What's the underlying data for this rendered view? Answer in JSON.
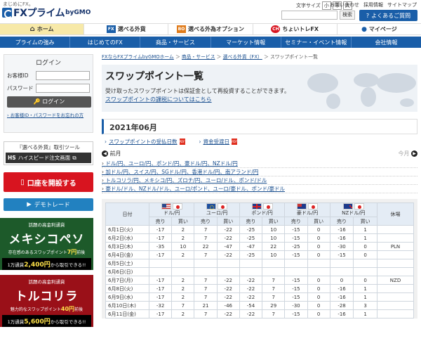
{
  "header": {
    "tagline": "まじめにFX。",
    "logo_text": "FXプライム",
    "logo_by": "byGMO",
    "font_size_label": "文字サイズ",
    "font_sizes": [
      "小",
      "中",
      "大"
    ],
    "top_links": [
      "お問い合わせ",
      "採用情報",
      "サイトマップ"
    ],
    "search_button": "検索",
    "faq_button": "よくあるご質問"
  },
  "global_nav": [
    {
      "label": "ホーム",
      "icon": "home-icon",
      "icon_text": "⌂"
    },
    {
      "label": "選べる外貨",
      "icon": "fx-icon",
      "icon_text": "FX"
    },
    {
      "label": "選べる外為オプション",
      "icon": "bo-icon",
      "icon_text": "BO"
    },
    {
      "label": "ちょいトレFX",
      "icon": "choitore-icon",
      "icon_text": "CH"
    },
    {
      "label": "マイページ",
      "icon": "user-icon",
      "icon_text": "●"
    }
  ],
  "sub_nav": [
    "プライムの強み",
    "はじめてのFX",
    "商品・サービス",
    "マーケット情報",
    "セミナー・イベント情報",
    "会社情報"
  ],
  "login": {
    "title": "ログイン",
    "id_label": "お客様ID",
    "password_label": "パスワード",
    "button": "ログイン",
    "forgot": "お客様ID・パスワードをお忘れの方"
  },
  "tool": {
    "title": "『選べる外貨』取引ツール",
    "button": "ハイスピード注文画面"
  },
  "open_account": "口座を開設する",
  "demo": "デモトレード",
  "banners": [
    {
      "small": "話題の高金利通貨",
      "big": "メキシコペソ",
      "swap_pre": "存在感のあるスワップポイント",
      "swap_val": "7円",
      "swap_post": "前後",
      "bottom_pre": "1万通貨",
      "bottom_val": "2,400円",
      "bottom_post": "から取引できる!!"
    },
    {
      "small": "話題の高金利通貨",
      "big": "トルコリラ",
      "swap_pre": "魅力的なスワップポイント",
      "swap_val": "40円",
      "swap_post": "前後",
      "bottom_pre": "1万通貨",
      "bottom_val": "5,600円",
      "bottom_post": "から取引できる!!"
    }
  ],
  "breadcrumb": {
    "items": [
      "FXならFXプライムbyGMOホーム",
      "商品・サービス",
      "選べる外貨（FX）"
    ],
    "current": "スワップポイント一覧",
    "separator": "＞"
  },
  "hero": {
    "title": "スワップポイント一覧",
    "desc": "受け取ったスワップポイントは保証金として再投資することができます。",
    "link": "スワップポイントの課税についてはこちら"
  },
  "month": "2021年06月",
  "files": [
    "スワップポイントの受払日数",
    "資金受渡日"
  ],
  "nav": {
    "prev": "前月",
    "next": "今月"
  },
  "pairs": [
    "ドル/円、ユーロ/円、ポンド/円、豪ドル/円、NZドル/円",
    "加ドル/円、スイス/円、SGドル/円、香港ドル/円、南アランド/円",
    "トルコリラ/円、メキシコ/円、ズロチ/円、ユーロ/ドル、ポンド/ドル",
    "豪ドル/ドル、NZドル/ドル、ユーロ/ポンド、ユーロ/豪ドル、ポンド/豪ドル"
  ],
  "table": {
    "date_header": "日付",
    "holiday_header": "休場",
    "sell": "売り",
    "buy": "買い",
    "currencies": [
      {
        "name": "ドル/円",
        "flag_a": "us-flag-icon",
        "flag_b": "jp-flag-icon"
      },
      {
        "name": "ユーロ/円",
        "flag_a": "eu-flag-icon",
        "flag_b": "jp-flag-icon"
      },
      {
        "name": "ポンド/円",
        "flag_a": "gb-flag-icon",
        "flag_b": "jp-flag-icon"
      },
      {
        "name": "豪ドル/円",
        "flag_a": "au-flag-icon",
        "flag_b": "jp-flag-icon"
      },
      {
        "name": "NZドル/円",
        "flag_a": "nz-flag-icon",
        "flag_b": "jp-flag-icon"
      }
    ],
    "rows": [
      {
        "date": "6月1日(火)",
        "values": [
          "-17",
          "2",
          "7",
          "-22",
          "-25",
          "10",
          "-15",
          "0",
          "-16",
          "1"
        ],
        "holiday": ""
      },
      {
        "date": "6月2日(水)",
        "values": [
          "-17",
          "2",
          "7",
          "-22",
          "-25",
          "10",
          "-15",
          "0",
          "-16",
          "1"
        ],
        "holiday": ""
      },
      {
        "date": "6月3日(木)",
        "values": [
          "-35",
          "10",
          "22",
          "-47",
          "-47",
          "22",
          "-25",
          "0",
          "-30",
          "0"
        ],
        "holiday": "PLN"
      },
      {
        "date": "6月4日(金)",
        "values": [
          "-17",
          "2",
          "7",
          "-22",
          "-25",
          "10",
          "-15",
          "0",
          "-15",
          "0"
        ],
        "holiday": ""
      },
      {
        "date": "6月5日(土)",
        "values": [
          "",
          "",
          "",
          "",
          "",
          "",
          "",
          "",
          "",
          ""
        ],
        "holiday": ""
      },
      {
        "date": "6月6日(日)",
        "values": [
          "",
          "",
          "",
          "",
          "",
          "",
          "",
          "",
          "",
          ""
        ],
        "holiday": ""
      },
      {
        "date": "6月7日(月)",
        "values": [
          "-17",
          "2",
          "7",
          "-22",
          "-22",
          "7",
          "-15",
          "0",
          "0",
          "0"
        ],
        "holiday": "NZD"
      },
      {
        "date": "6月8日(火)",
        "values": [
          "-17",
          "2",
          "7",
          "-22",
          "-22",
          "7",
          "-15",
          "0",
          "-16",
          "1"
        ],
        "holiday": ""
      },
      {
        "date": "6月9日(水)",
        "values": [
          "-17",
          "2",
          "7",
          "-22",
          "-22",
          "7",
          "-15",
          "0",
          "-16",
          "1"
        ],
        "holiday": ""
      },
      {
        "date": "6月10日(木)",
        "values": [
          "-32",
          "7",
          "21",
          "-46",
          "-54",
          "29",
          "-30",
          "0",
          "-28",
          "3"
        ],
        "holiday": ""
      },
      {
        "date": "6月11日(金)",
        "values": [
          "-17",
          "2",
          "7",
          "-22",
          "-22",
          "7",
          "-15",
          "0",
          "-16",
          "1"
        ],
        "holiday": ""
      }
    ]
  },
  "colors": {
    "brand_blue": "#1a5ea8",
    "home_active": "#f7e9a8",
    "open_red": "#d8141f",
    "demo_blue": "#2281c0"
  }
}
